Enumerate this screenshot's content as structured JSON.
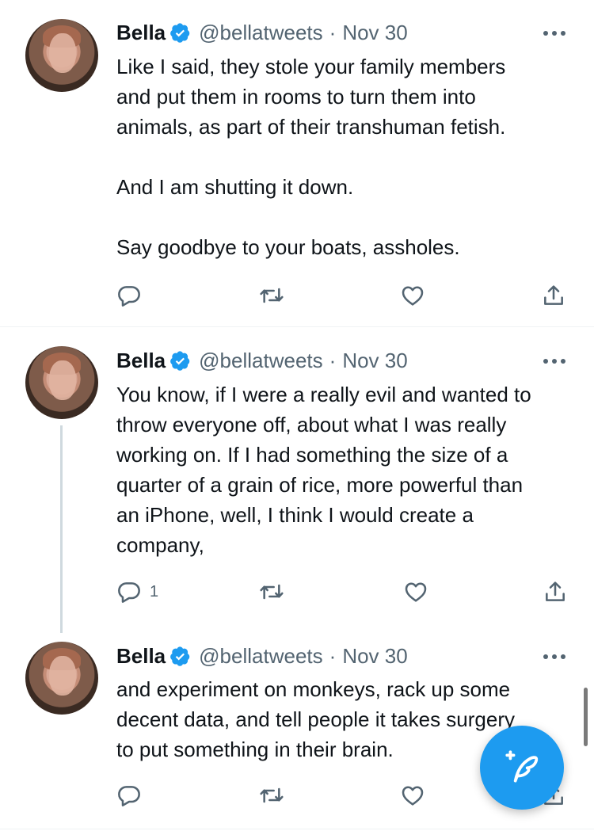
{
  "colors": {
    "accent": "#1d9bf0",
    "text_primary": "#0f1419",
    "text_secondary": "#536471",
    "divider": "#eff3f4"
  },
  "icons": {
    "verified": "verified-badge-icon",
    "more": "more-horizontal-icon",
    "reply": "reply-icon",
    "retweet": "retweet-icon",
    "like": "heart-icon",
    "share": "share-icon",
    "compose": "compose-tweet-icon"
  },
  "tweets": [
    {
      "name": "Bella",
      "handle": "@bellatweets",
      "separator": "·",
      "date": "Nov 30",
      "lines": [
        "Like I said, they stole your family members",
        "and put them in rooms to turn them into",
        "animals, as part of their transhuman fetish.",
        "",
        "And I am shutting it down.",
        "",
        "Say goodbye to your boats, assholes."
      ],
      "reply_count": ""
    },
    {
      "name": "Bella",
      "handle": "@bellatweets",
      "separator": "·",
      "date": "Nov 30",
      "lines": [
        "You know, if I were a really evil and wanted to",
        "throw everyone off, about what I was really",
        "working on. If I had something the size of a",
        "quarter of a grain of rice, more powerful than",
        "an iPhone, well, I think I would create a",
        "company,"
      ],
      "reply_count": "1"
    },
    {
      "name": "Bella",
      "handle": "@bellatweets",
      "separator": "·",
      "date": "Nov 30",
      "lines": [
        "and experiment on monkeys, rack up some",
        "decent data, and tell people it takes surgery",
        "to put something in their brain."
      ],
      "reply_count": ""
    }
  ]
}
